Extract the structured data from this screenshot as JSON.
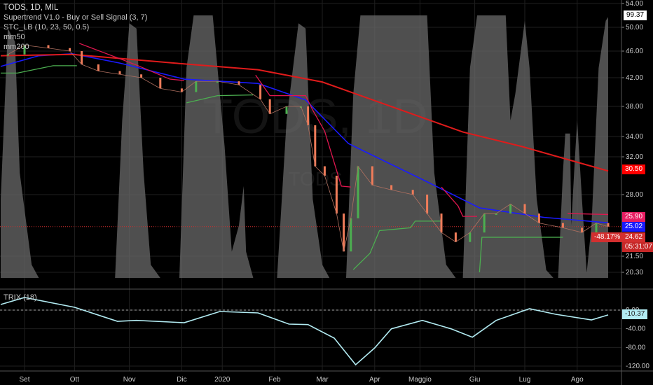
{
  "header": {
    "symbol_title": "TODS, 1D, MIL",
    "indicators": [
      "Supertrend V1.0 - Buy or Sell Signal (3, 7)",
      "STC_LB (10, 23, 50, 0.5)",
      "mm50",
      "mm200"
    ],
    "watermark": "TODS, 1D",
    "watermark_sub": "TODS"
  },
  "price_tags": {
    "stc": "99.37",
    "mm200": "30.50",
    "supertrend": "25.90",
    "mm50": "25.02",
    "last": "24.62",
    "countdown": "05:31:07",
    "change_pct": "-48.17%"
  },
  "trix": {
    "label": "TRIX (18)",
    "value_tag": "-10.37"
  },
  "colors": {
    "up": "#4caf50",
    "down": "#ef7c5a",
    "mm50": "#1a1aff",
    "mm200": "#e01b1b",
    "st_green": "#4caf50",
    "st_red": "#e0164f",
    "stc": "#6a6a6a",
    "trix": "#b2ebf2"
  },
  "chart_data": [
    {
      "type": "line",
      "title": "TODS, 1D, MIL",
      "x_unit": "trading day index (0 = early Sep 2019)",
      "x_ticks": [
        {
          "i": 0,
          "label": "Set"
        },
        {
          "i": 21,
          "label": "Ott"
        },
        {
          "i": 44,
          "label": "Nov"
        },
        {
          "i": 66,
          "label": "Dic"
        },
        {
          "i": 83,
          "label": "2020"
        },
        {
          "i": 105,
          "label": "Feb"
        },
        {
          "i": 125,
          "label": "Mar"
        },
        {
          "i": 147,
          "label": "Apr"
        },
        {
          "i": 166,
          "label": "Maggio"
        },
        {
          "i": 189,
          "label": "Giu"
        },
        {
          "i": 210,
          "label": "Lug"
        },
        {
          "i": 232,
          "label": "Ago"
        }
      ],
      "y_ticks": [
        "54.00",
        "50.00",
        "46.00",
        "42.00",
        "38.00",
        "34.00",
        "32.00",
        "28.00",
        "21.50",
        "20.30"
      ],
      "ylim": [
        20.3,
        54
      ],
      "series": [
        {
          "name": "price",
          "points": [
            [
              -7,
              45.5
            ],
            [
              0,
              47
            ],
            [
              10,
              46.5
            ],
            [
              19,
              46
            ],
            [
              24,
              44
            ],
            [
              31,
              43
            ],
            [
              40,
              42.5
            ],
            [
              49,
              42
            ],
            [
              57,
              40.5
            ],
            [
              66,
              40
            ],
            [
              72,
              41.5
            ],
            [
              81,
              41.5
            ],
            [
              90,
              41
            ],
            [
              99,
              39
            ],
            [
              103,
              37
            ],
            [
              110,
              38
            ],
            [
              116,
              38
            ],
            [
              119,
              35.5
            ],
            [
              122,
              31
            ],
            [
              126,
              30
            ],
            [
              131,
              26
            ],
            [
              134,
              22
            ],
            [
              137,
              25.5
            ],
            [
              140,
              31
            ],
            [
              146,
              29
            ],
            [
              154,
              28.5
            ],
            [
              163,
              28
            ],
            [
              169,
              26
            ],
            [
              175,
              24
            ],
            [
              181,
              23
            ],
            [
              187,
              24
            ],
            [
              193,
              26
            ],
            [
              198,
              26
            ],
            [
              204,
              27
            ],
            [
              210,
              26
            ],
            [
              216,
              25
            ],
            [
              226,
              24.5
            ],
            [
              234,
              24
            ],
            [
              240,
              25
            ],
            [
              245,
              24.62
            ]
          ]
        },
        {
          "name": "mm50",
          "points": [
            [
              -10,
              43.7
            ],
            [
              6,
              45.3
            ],
            [
              20,
              45.6
            ],
            [
              40,
              44.2
            ],
            [
              67,
              41.8
            ],
            [
              98,
              41.2
            ],
            [
              118,
              38.9
            ],
            [
              136,
              33.3
            ],
            [
              167,
              29.6
            ],
            [
              191,
              26.6
            ],
            [
              218,
              25.6
            ],
            [
              245,
              25.02
            ]
          ]
        },
        {
          "name": "mm200",
          "points": [
            [
              -10,
              45.3
            ],
            [
              20,
              45.5
            ],
            [
              66,
              44.1
            ],
            [
              98,
              43.2
            ],
            [
              125,
              41.4
            ],
            [
              142,
              39.4
            ],
            [
              184,
              34.6
            ],
            [
              209,
              33.0
            ],
            [
              245,
              30.5
            ]
          ]
        },
        {
          "name": "supertrend",
          "segments": [
            {
              "trend": "up",
              "points": [
                [
                  -10,
                  42.7
                ],
                [
                  -3,
                  42.7
                ],
                [
                  12,
                  43.8
                ],
                [
                  22,
                  43.8
                ]
              ]
            },
            {
              "trend": "down",
              "points": [
                [
                  23,
                  47.3
                ],
                [
                  47,
                  43.9
                ],
                [
                  61,
                  41.8
                ],
                [
                  67,
                  41.6
                ]
              ]
            },
            {
              "trend": "up",
              "points": [
                [
                  68,
                  38.5
                ],
                [
                  81,
                  39.5
                ],
                [
                  96,
                  39.6
                ]
              ]
            },
            {
              "trend": "down",
              "points": [
                [
                  97,
                  42.4
                ],
                [
                  103,
                  39.5
                ],
                [
                  118,
                  39.5
                ],
                [
                  121,
                  37.5
                ],
                [
                  126,
                  34.7
                ],
                [
                  133,
                  28.9
                ],
                [
                  137,
                  28.8
                ]
              ]
            },
            {
              "trend": "up",
              "points": [
                [
                  138,
                  20.5
                ],
                [
                  145,
                  21.8
                ],
                [
                  149,
                  24.2
                ],
                [
                  162,
                  24.5
                ],
                [
                  164,
                  25.2
                ],
                [
                  175,
                  25.2
                ]
              ]
            },
            {
              "trend": "down",
              "points": [
                [
                  175,
                  28.8
                ],
                [
                  182,
                  26.8
                ],
                [
                  184,
                  25.7
                ],
                [
                  190,
                  25.7
                ]
              ]
            },
            {
              "trend": "up",
              "points": [
                [
                  191,
                  20.3
                ],
                [
                  192,
                  23.5
                ],
                [
                  226,
                  23.5
                ]
              ]
            },
            {
              "trend": "down",
              "points": [
                [
                  228,
                  26.0
                ],
                [
                  245,
                  25.9
                ]
              ]
            }
          ]
        }
      ]
    },
    {
      "type": "area",
      "name": "STC_LB",
      "ylim": [
        0,
        100
      ],
      "points": [
        [
          -10,
          30
        ],
        [
          -7,
          95
        ],
        [
          -4,
          90
        ],
        [
          -2,
          40
        ],
        [
          3,
          5
        ],
        [
          6,
          0
        ],
        [
          38,
          0
        ],
        [
          41,
          60
        ],
        [
          44,
          97
        ],
        [
          47,
          95
        ],
        [
          50,
          40
        ],
        [
          53,
          5
        ],
        [
          57,
          0
        ],
        [
          65,
          0
        ],
        [
          68,
          80
        ],
        [
          71,
          100
        ],
        [
          79,
          100
        ],
        [
          84,
          50
        ],
        [
          87,
          10
        ],
        [
          90,
          20
        ],
        [
          92,
          35
        ],
        [
          93,
          10
        ],
        [
          96,
          0
        ],
        [
          106,
          0
        ],
        [
          110,
          60
        ],
        [
          115,
          97
        ],
        [
          118,
          95
        ],
        [
          121,
          30
        ],
        [
          125,
          5
        ],
        [
          128,
          0
        ],
        [
          135,
          0
        ],
        [
          138,
          70
        ],
        [
          141,
          100
        ],
        [
          169,
          100
        ],
        [
          172,
          40
        ],
        [
          177,
          5
        ],
        [
          181,
          0
        ],
        [
          184,
          0
        ],
        [
          187,
          80
        ],
        [
          190,
          100
        ],
        [
          202,
          100
        ],
        [
          204,
          60
        ],
        [
          206,
          70
        ],
        [
          210,
          98
        ],
        [
          212,
          80
        ],
        [
          215,
          30
        ],
        [
          219,
          3
        ],
        [
          222,
          0
        ],
        [
          224,
          0
        ],
        [
          226,
          40
        ],
        [
          227,
          55
        ],
        [
          229,
          55
        ],
        [
          229.5,
          20
        ],
        [
          231,
          45
        ],
        [
          232,
          60
        ],
        [
          234,
          30
        ],
        [
          236,
          2
        ],
        [
          238,
          20
        ],
        [
          241,
          80
        ],
        [
          244,
          98
        ],
        [
          245,
          99.37
        ]
      ]
    },
    {
      "type": "line",
      "name": "TRIX (18)",
      "y_ticks": [
        "0.00",
        "-40.00",
        "-80.00",
        "-120.00"
      ],
      "ylim": [
        -125,
        30
      ],
      "points": [
        [
          -10,
          12
        ],
        [
          0,
          27
        ],
        [
          21,
          6
        ],
        [
          39,
          -24
        ],
        [
          47,
          -22
        ],
        [
          67,
          -27
        ],
        [
          82,
          -3
        ],
        [
          98,
          -6
        ],
        [
          111,
          -30
        ],
        [
          119,
          -31
        ],
        [
          130,
          -60
        ],
        [
          139,
          -117
        ],
        [
          147,
          -81
        ],
        [
          154,
          -40
        ],
        [
          167,
          -22
        ],
        [
          179,
          -40
        ],
        [
          188,
          -58
        ],
        [
          198,
          -22
        ],
        [
          212,
          3
        ],
        [
          223,
          -9
        ],
        [
          238,
          -21
        ],
        [
          245,
          -10.37
        ]
      ]
    }
  ]
}
